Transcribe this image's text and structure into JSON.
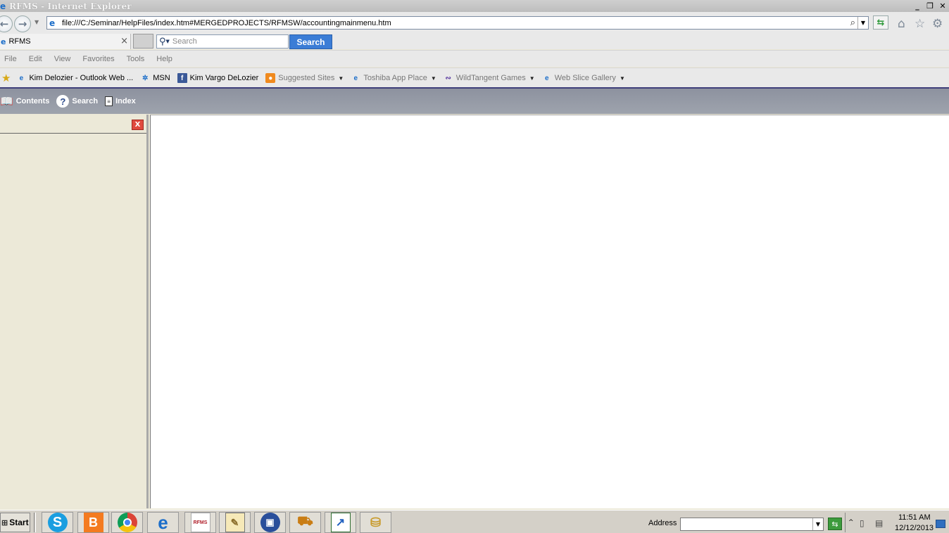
{
  "window": {
    "title": "RFMS - Internet Explorer"
  },
  "address": {
    "url": "file:///C:/Seminar/HelpFiles/index.htm#MERGEDPROJECTS/RFMSW/accountingmainmenu.htm"
  },
  "tab": {
    "label": "RFMS"
  },
  "search": {
    "placeholder": "Search",
    "button_label": "Search"
  },
  "menu": [
    "File",
    "Edit",
    "View",
    "Favorites",
    "Tools",
    "Help"
  ],
  "favorites": [
    {
      "label": "Kim Delozier - Outlook Web ...",
      "icon": "ie-page-icon"
    },
    {
      "label": "MSN",
      "icon": "msn-icon"
    },
    {
      "label": "Kim Vargo DeLozier",
      "icon": "facebook-icon"
    },
    {
      "label": "Suggested Sites",
      "icon": "suggested-sites-icon"
    },
    {
      "label": "Toshiba App Place",
      "icon": "ie-page-icon"
    },
    {
      "label": "WildTangent Games",
      "icon": "wildtangent-icon"
    },
    {
      "label": "Web Slice Gallery",
      "icon": "ie-page-icon"
    }
  ],
  "helpbar": {
    "contents": "Contents",
    "search": "Search",
    "index": "Index"
  },
  "taskbar": {
    "start": "Start",
    "address_label": "Address",
    "time": "11:51 AM",
    "date": "12/12/2013",
    "apps": [
      "skype",
      "blogger",
      "chrome",
      "internet-explorer",
      "rfms",
      "notepad",
      "remote-desktop",
      "forklift",
      "chart",
      "coins"
    ]
  },
  "colors": {
    "search_button": "#3b7dd6",
    "helpbar": "#959aa5",
    "pane_close": "#e04a3f"
  }
}
